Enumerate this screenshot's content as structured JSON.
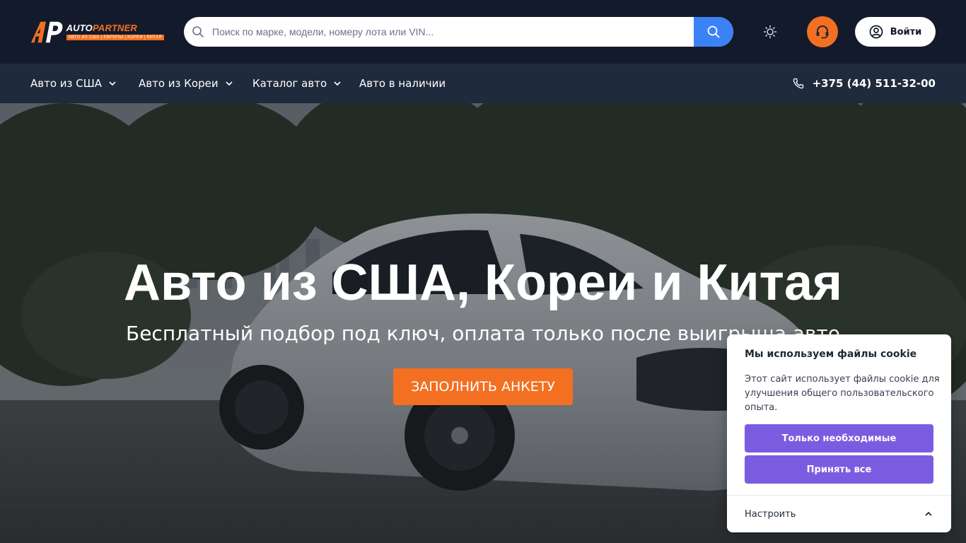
{
  "brand": {
    "name_part1": "AUTO",
    "name_part2": "PARTNER",
    "tagline": "АВТО ИЗ США | ЕВРОПЫ | КОРЕИ | КИТАЯ",
    "logo_icon": "ap-logo-icon"
  },
  "header": {
    "search_placeholder": "Поиск по марке, модели, номеру лота или VIN...",
    "search_icon": "search-icon",
    "theme_icon": "sun-icon",
    "support_icon": "headset-icon",
    "login_label": "Войти",
    "login_icon": "user-circle-icon"
  },
  "nav": {
    "items": [
      {
        "label": "Авто из США",
        "has_dropdown": true
      },
      {
        "label": "Авто из Кореи",
        "has_dropdown": true
      },
      {
        "label": "Каталог авто",
        "has_dropdown": true
      },
      {
        "label": "Авто в наличии",
        "has_dropdown": false
      }
    ],
    "phone": "+375 (44) 511-32-00",
    "phone_icon": "phone-icon"
  },
  "hero": {
    "title": "Авто из США, Кореи и Китая",
    "subtitle": "Бесплатный подбор под ключ, оплата только после выигрыша авто",
    "cta_label": "ЗАПОЛНИТЬ АНКЕТУ"
  },
  "cookie": {
    "title": "Мы используем файлы cookie",
    "text": "Этот сайт использует файлы cookie для улучшения общего пользовательского опыта.",
    "btn_necessary": "Только необходимые",
    "btn_accept_all": "Принять все",
    "settings_label": "Настроить",
    "settings_icon": "chevron-up-icon"
  },
  "colors": {
    "header_bg": "#131a2b",
    "nav_bg": "#1f2a3d",
    "accent_orange": "#f36f22",
    "search_button": "#3b82f6",
    "cookie_button": "#7b5ce0"
  }
}
